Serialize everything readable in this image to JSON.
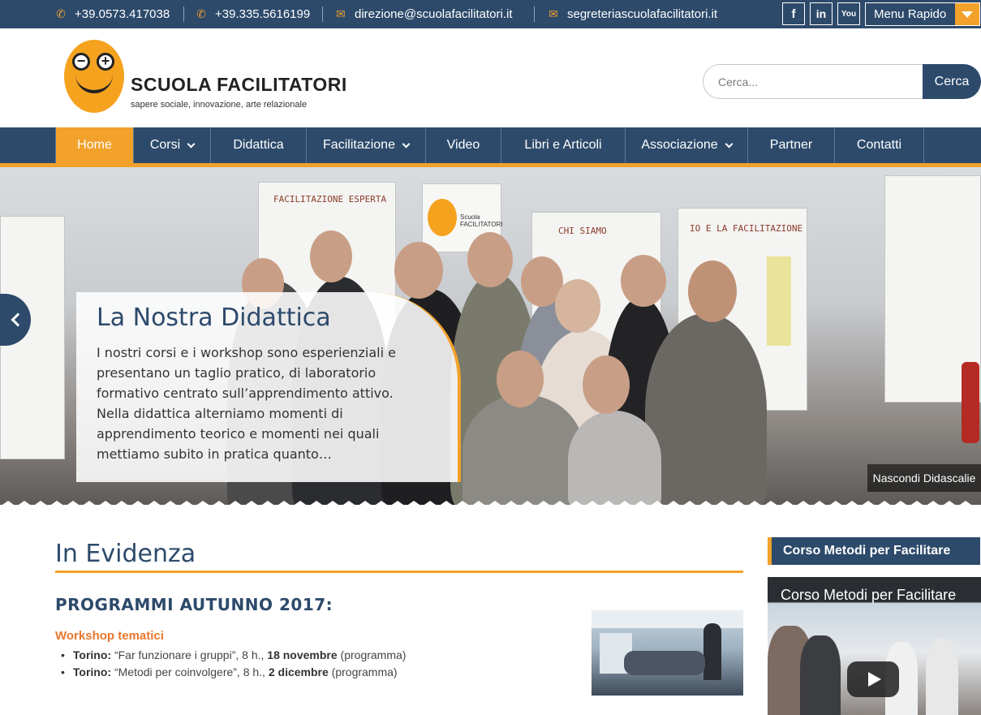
{
  "topbar": {
    "phone1": "+39.0573.417038",
    "phone2": "+39.335.5616199",
    "email1": "direzione@scuolafacilitatori.it",
    "email2": "segreteriascuolafacilitatori.it",
    "social": [
      "f",
      "in",
      "You"
    ],
    "menu_rapido": "Menu Rapido"
  },
  "header": {
    "brand": "SCUOLA FACILITATORI",
    "tagline": "sapere sociale, innovazione, arte relazionale",
    "search_placeholder": "Cerca...",
    "search_button": "Cerca"
  },
  "nav": {
    "items": [
      {
        "label": "Home"
      },
      {
        "label": "Corsi"
      },
      {
        "label": "Didattica"
      },
      {
        "label": "Facilitazione"
      },
      {
        "label": "Video"
      },
      {
        "label": "Libri e Articoli"
      },
      {
        "label": "Associazione"
      },
      {
        "label": "Partner"
      },
      {
        "label": "Contatti"
      }
    ]
  },
  "slider": {
    "caption_title": "La Nostra Didattica",
    "caption_text": "I nostri corsi e i workshop sono esperienziali e presentano un taglio pratico, di laboratorio formativo centrato sull’apprendimento attivo. Nella didattica alterniamo momenti di apprendimento teorico e momenti nei quali mettiamo subito in pratica quanto…",
    "hide_caption": "Nascondi Didascalie",
    "photo_logo_text": "Scuola FACILITATORI",
    "board_texts": [
      "FACILITAZIONE ESPERTA",
      "CHI SIAMO",
      "IO E LA FACILITAZIONE"
    ]
  },
  "main": {
    "section_title": "In Evidenza",
    "program_title": "PROGRAMMI AUTUNNO 2017:",
    "workshop_title": "Workshop tematici",
    "workshops": [
      {
        "city": "Torino:",
        "text": " “Far funzionare i gruppi”, 8 h., ",
        "date": "18 novembre",
        "link": " (programma)"
      },
      {
        "city": "Torino:",
        "text": " “Metodi per coinvolgere”, 8 h., ",
        "date": "2 dicembre",
        "link": " (programma)"
      }
    ]
  },
  "sidebar": {
    "widget_title": "Corso Metodi per Facilitare",
    "video_title": "Corso Metodi per Facilitare"
  },
  "colors": {
    "navy": "#2d4a6b",
    "orange": "#f2a12a",
    "link_orange": "#e8772e"
  }
}
